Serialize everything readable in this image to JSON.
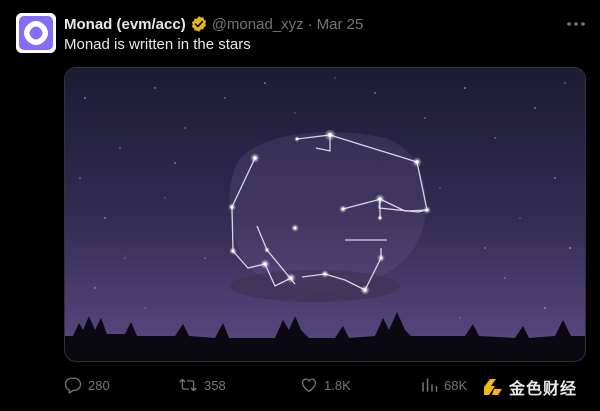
{
  "tweet": {
    "display_name": "Monad (evm/acc)",
    "handle": "@monad_xyz",
    "separator": "·",
    "date": "Mar 25",
    "text": "Monad is written in the stars",
    "verified_badge_color": "#e2b719",
    "avatar_color": "#836ef9",
    "media": {
      "description_icon": "constellation-image",
      "sky_top_color": "#1c1b33",
      "sky_bottom_color": "#5b4c86"
    }
  },
  "actions": {
    "replies": "280",
    "retweets": "358",
    "likes": "1.8K",
    "views": "68K"
  },
  "watermark": {
    "text": "金色财经",
    "color": "#f0b90b"
  }
}
